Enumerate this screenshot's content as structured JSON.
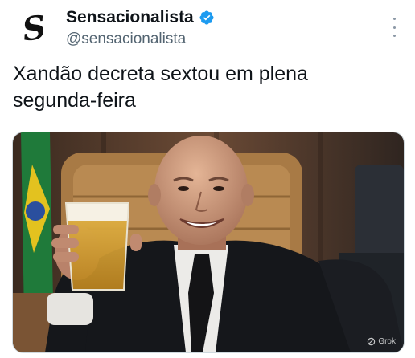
{
  "post": {
    "display_name": "Sensacionalista",
    "handle": "@sensacionalista",
    "avatar_glyph": "S",
    "text": "Xandão decreta sextou em plena segunda-feira"
  },
  "media": {
    "watermark": "Grok"
  },
  "colors": {
    "verified": "#1d9bf0",
    "handle": "#536471",
    "text": "#0f1419"
  },
  "icons": [
    "verified-badge-icon",
    "more-options-icon",
    "grok-icon"
  ]
}
